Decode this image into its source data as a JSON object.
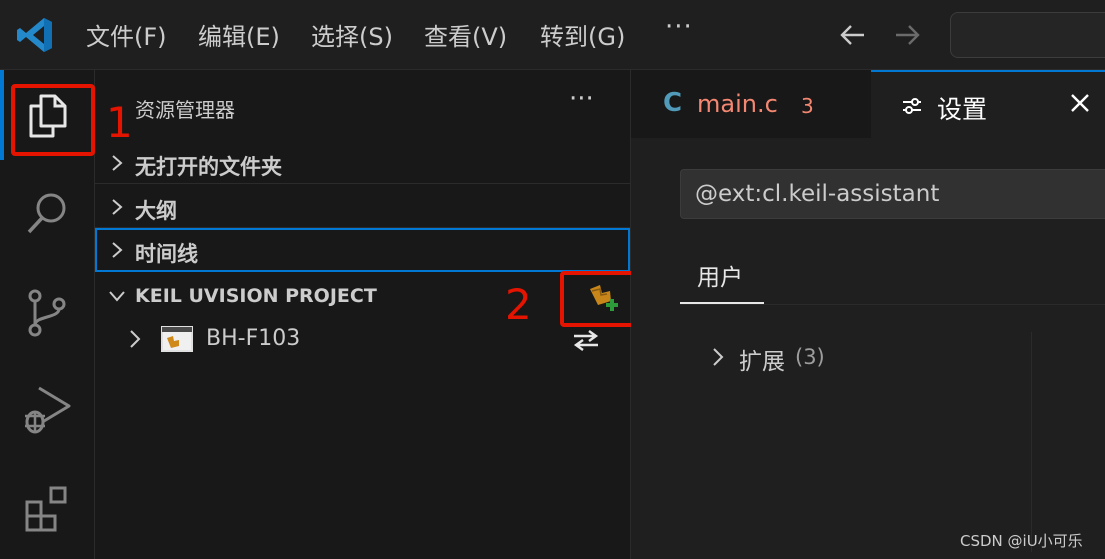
{
  "titlebar": {
    "menus": [
      "文件(F)",
      "编辑(E)",
      "选择(S)",
      "查看(V)",
      "转到(G)"
    ],
    "more": "···"
  },
  "activity_bar": {
    "icons": [
      "explorer-icon",
      "search-icon",
      "source-control-icon",
      "run-debug-icon",
      "extensions-icon"
    ],
    "accent": "#0078d4"
  },
  "sidebar": {
    "title": "资源管理器",
    "more": "···",
    "sections": [
      "无打开的文件夹",
      "大纲",
      "时间线",
      "KEIL UVISION PROJECT"
    ],
    "project_item": "BH-F103"
  },
  "annotations": {
    "box1_number": "1",
    "box2_number": "2",
    "color": "#e51400"
  },
  "editor": {
    "tabs": [
      {
        "icon": "C",
        "name": "main.c",
        "problems": "3"
      },
      {
        "name": "设置"
      }
    ],
    "settings_search": "@ext:cl.keil-assistant",
    "scope_tab": "用户",
    "tree_label": "扩展",
    "tree_count": "(3)"
  },
  "watermark": "CSDN @iU小可乐"
}
